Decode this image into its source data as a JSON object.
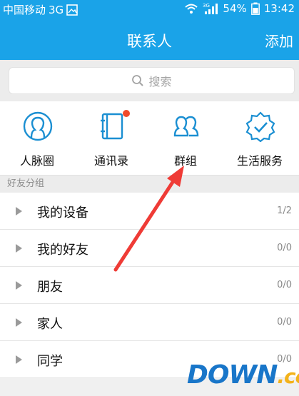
{
  "status_bar": {
    "carrier": "中国移动",
    "network": "3G",
    "battery": "54%",
    "time": "13:42"
  },
  "header": {
    "title": "联系人",
    "add_label": "添加"
  },
  "search": {
    "placeholder": "搜索"
  },
  "quick_actions": [
    {
      "label": "人脉圈",
      "icon": "contact-circle-icon"
    },
    {
      "label": "通讯录",
      "icon": "address-book-icon",
      "badge": true
    },
    {
      "label": "群组",
      "icon": "group-icon"
    },
    {
      "label": "生活服务",
      "icon": "life-service-icon"
    }
  ],
  "section": {
    "title": "好友分组"
  },
  "groups": [
    {
      "name": "我的设备",
      "count": "1/2"
    },
    {
      "name": "我的好友",
      "count": "0/0"
    },
    {
      "name": "朋友",
      "count": "0/0"
    },
    {
      "name": "家人",
      "count": "0/0"
    },
    {
      "name": "同学",
      "count": "0/0"
    }
  ],
  "watermark": {
    "main": "DOWN",
    "suffix": ".cc"
  },
  "colors": {
    "accent": "#1aa3e8",
    "icon_blue": "#1b8fd2",
    "badge": "#f04a2b",
    "arrow": "#ef3b36"
  }
}
